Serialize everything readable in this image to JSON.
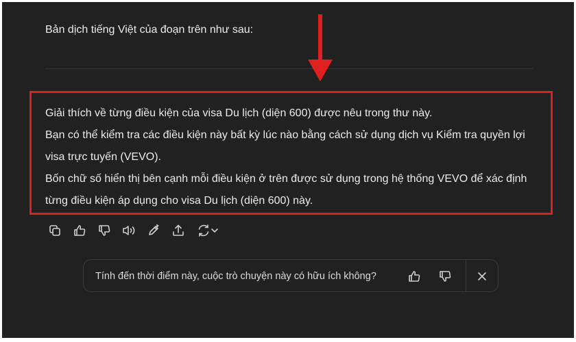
{
  "chat": {
    "intro_text": "Bản dịch tiếng Việt của đoạn trên như sau:",
    "translation_paragraphs": [
      "Giải thích về từng điều kiện của visa Du lịch (diện 600) được nêu trong thư này.",
      "Bạn có thể kiểm tra các điều kiện này bất kỳ lúc nào bằng cách sử dụng dịch vụ Kiểm tra quyền lợi visa trực tuyến (VEVO).",
      "Bốn chữ số hiển thị bên cạnh mỗi điều kiện ở trên được sử dụng trong hệ thống VEVO để xác định từng điều kiện áp dụng cho visa Du lịch (diện 600) này."
    ]
  },
  "action_bar": {
    "icons": [
      "copy-icon",
      "thumbs-up-icon",
      "thumbs-down-icon",
      "read-aloud-icon",
      "edit-icon",
      "share-icon",
      "regenerate-icon",
      "chevron-down-icon"
    ]
  },
  "feedback": {
    "question": "Tính đến thời điểm này, cuộc trò chuyện này có hữu ích không?",
    "icons": [
      "thumbs-up-icon",
      "thumbs-down-icon",
      "close-icon"
    ]
  },
  "colors": {
    "background": "#212121",
    "text": "#ececec",
    "annotation_red": "#e0201f",
    "border": "#3a3a3a"
  }
}
